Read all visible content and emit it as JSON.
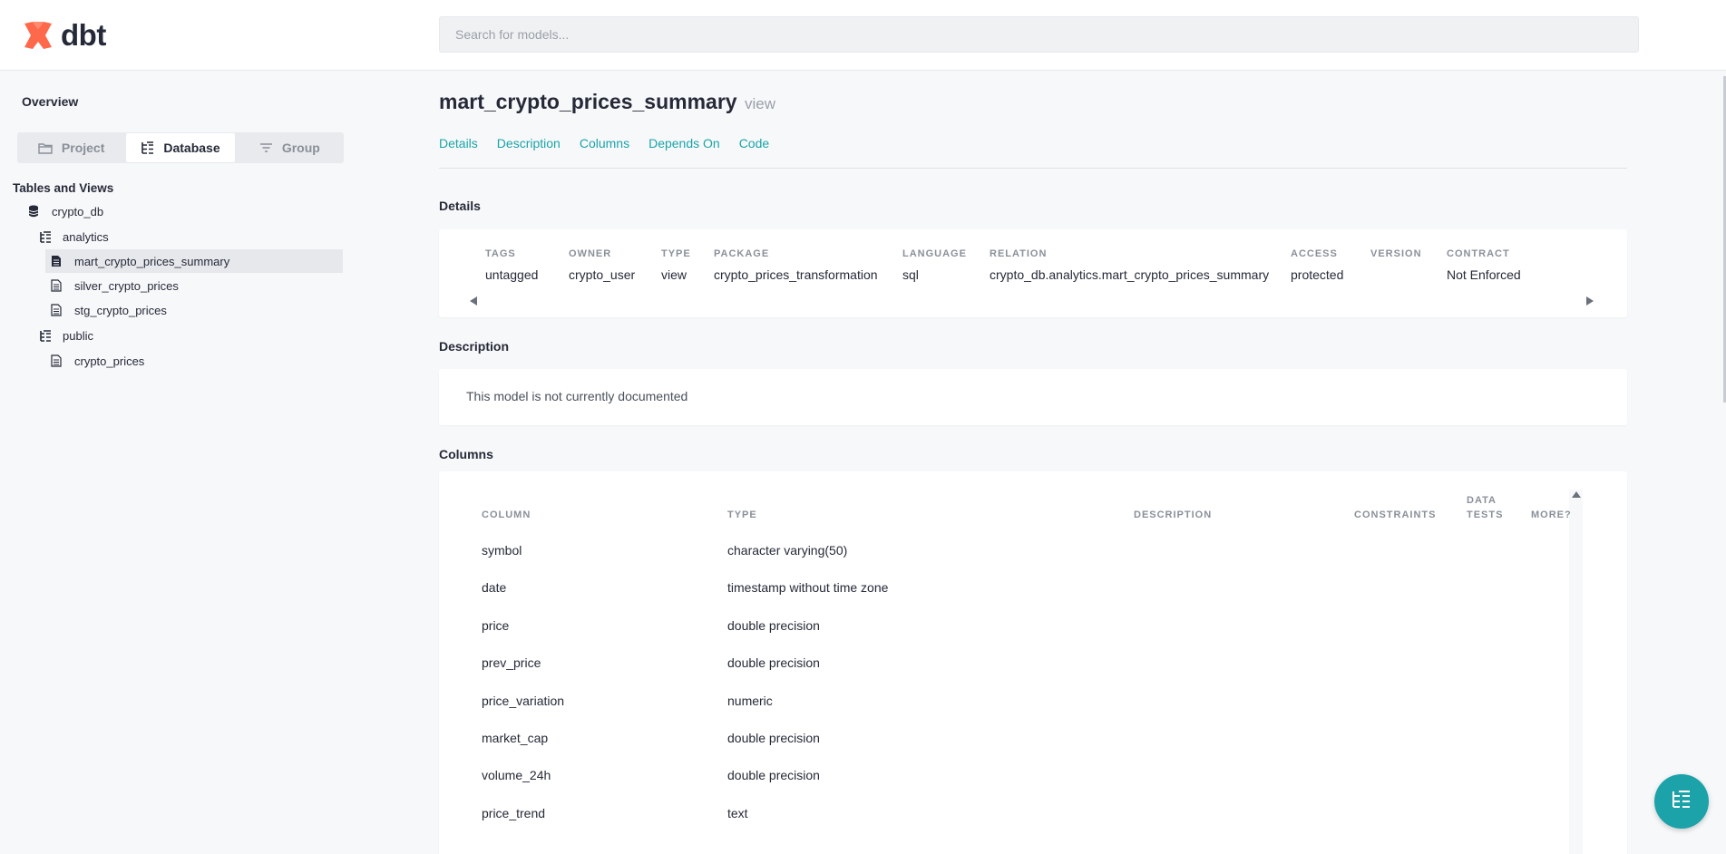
{
  "header": {
    "logo_text": "dbt",
    "search_placeholder": "Search for models..."
  },
  "sidebar": {
    "overview": "Overview",
    "tabs": [
      {
        "label": "Project",
        "icon": "folder-icon"
      },
      {
        "label": "Database",
        "icon": "tree-icon"
      },
      {
        "label": "Group",
        "icon": "filter-icon"
      }
    ],
    "active_tab": "Database",
    "section_label": "Tables and Views",
    "tree": [
      {
        "label": "crypto_db",
        "icon": "database-icon"
      },
      {
        "label": "analytics",
        "icon": "schema-icon"
      },
      {
        "label": "mart_crypto_prices_summary",
        "icon": "file-icon",
        "selected": true
      },
      {
        "label": "silver_crypto_prices",
        "icon": "file-icon"
      },
      {
        "label": "stg_crypto_prices",
        "icon": "file-icon"
      },
      {
        "label": "public",
        "icon": "schema-icon"
      },
      {
        "label": "crypto_prices",
        "icon": "file-icon"
      }
    ]
  },
  "main": {
    "title": "mart_crypto_prices_summary",
    "kind": "view",
    "tabs": [
      "Details",
      "Description",
      "Columns",
      "Depends On",
      "Code"
    ],
    "details_heading": "Details",
    "details": [
      {
        "label": "TAGS",
        "value": "untagged"
      },
      {
        "label": "OWNER",
        "value": "crypto_user"
      },
      {
        "label": "TYPE",
        "value": "view"
      },
      {
        "label": "PACKAGE",
        "value": "crypto_prices_transformation"
      },
      {
        "label": "LANGUAGE",
        "value": "sql"
      },
      {
        "label": "RELATION",
        "value": "crypto_db.analytics.mart_crypto_prices_summary"
      },
      {
        "label": "ACCESS",
        "value": "protected"
      },
      {
        "label": "VERSION",
        "value": ""
      },
      {
        "label": "CONTRACT",
        "value": "Not Enforced"
      }
    ],
    "description_heading": "Description",
    "description_text": "This model is not currently documented",
    "columns_heading": "Columns",
    "column_headers": {
      "column": "COLUMN",
      "type": "TYPE",
      "description": "DESCRIPTION",
      "constraints": "CONSTRAINTS",
      "data_tests_1": "DATA",
      "data_tests_2": "TESTS",
      "more": "MORE?"
    },
    "columns": [
      {
        "name": "symbol",
        "type": "character varying(50)"
      },
      {
        "name": "date",
        "type": "timestamp without time zone"
      },
      {
        "name": "price",
        "type": "double precision"
      },
      {
        "name": "prev_price",
        "type": "double precision"
      },
      {
        "name": "price_variation",
        "type": "numeric"
      },
      {
        "name": "market_cap",
        "type": "double precision"
      },
      {
        "name": "volume_24h",
        "type": "double precision"
      },
      {
        "name": "price_trend",
        "type": "text"
      }
    ]
  },
  "colors": {
    "accent": "#1ba3a9",
    "logo": "#ff694b"
  }
}
